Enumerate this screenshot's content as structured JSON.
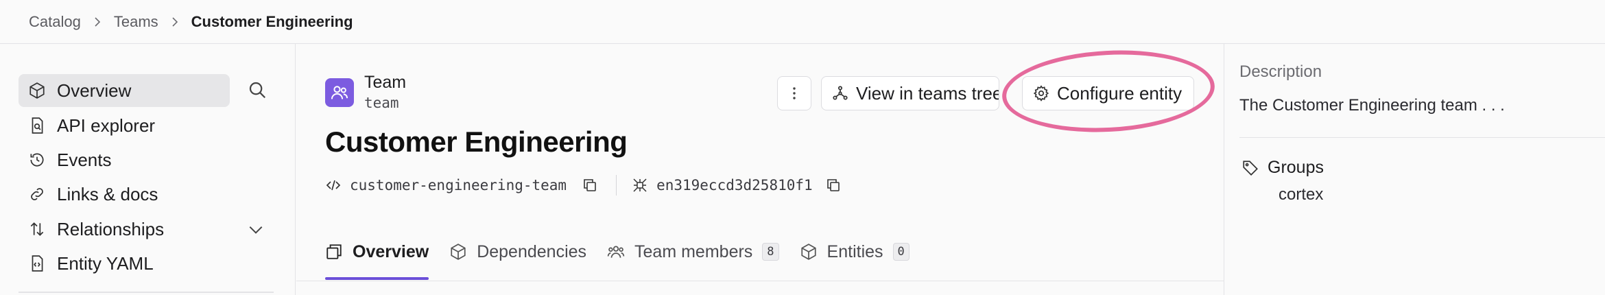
{
  "breadcrumb": {
    "items": [
      "Catalog",
      "Teams"
    ],
    "current": "Customer Engineering"
  },
  "sidebar": {
    "items": [
      {
        "label": "Overview",
        "icon": "cube-icon"
      },
      {
        "label": "API explorer",
        "icon": "document-search-icon"
      },
      {
        "label": "Events",
        "icon": "history-icon"
      },
      {
        "label": "Links & docs",
        "icon": "link-icon"
      },
      {
        "label": "Relationships",
        "icon": "arrows-updown-icon"
      },
      {
        "label": "Entity YAML",
        "icon": "code-file-icon"
      }
    ]
  },
  "header": {
    "type_title": "Team",
    "type_sub": "team",
    "title": "Customer Engineering",
    "tag": "customer-engineering-team",
    "id": "en319eccd3d25810f1",
    "buttons": {
      "tree": "View in teams tree",
      "configure": "Configure entity"
    }
  },
  "tabs": [
    {
      "label": "Overview",
      "active": true
    },
    {
      "label": "Dependencies"
    },
    {
      "label": "Team members",
      "count": "8"
    },
    {
      "label": "Entities",
      "count": "0"
    }
  ],
  "panel": {
    "description_label": "Description",
    "description_text": "The Customer Engineering team . . .",
    "groups_label": "Groups",
    "group_value": "cortex"
  },
  "colors": {
    "accent": "#6b4fd8",
    "badge": "#7c5ce0",
    "highlight": "#e56a9c"
  }
}
